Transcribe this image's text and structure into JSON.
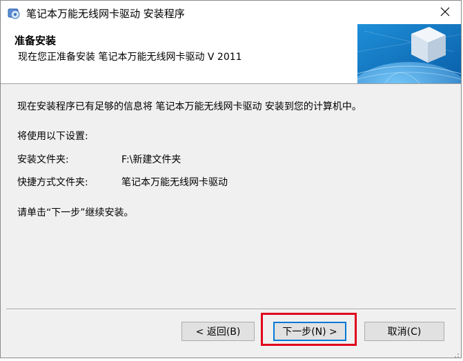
{
  "window": {
    "title": "笔记本万能无线网卡驱动 安装程序"
  },
  "header": {
    "title": "准备安装",
    "subtitle": "现在您正准备安装 笔记本万能无线网卡驱动 V 2011"
  },
  "body": {
    "intro": "现在安装程序已有足够的信息将 笔记本万能无线网卡驱动 安装到您的计算机中。",
    "settings_heading": "将使用以下设置:",
    "settings": [
      {
        "label": "安装文件夹:",
        "value": "F:\\新建文件夹"
      },
      {
        "label": "快捷方式文件夹:",
        "value": "笔记本万能无线网卡驱动"
      }
    ],
    "instruction": "请单击“下一步”继续安装。"
  },
  "buttons": {
    "back": "< 返回(B)",
    "next": "下一步(N) >",
    "cancel": "取消(C)"
  },
  "icons": {
    "app": "installer-icon",
    "close": "close-icon",
    "header_graphic": "globe-cube-graphic"
  },
  "colors": {
    "highlight": "#e0001b",
    "default_button_border": "#0078d7"
  }
}
